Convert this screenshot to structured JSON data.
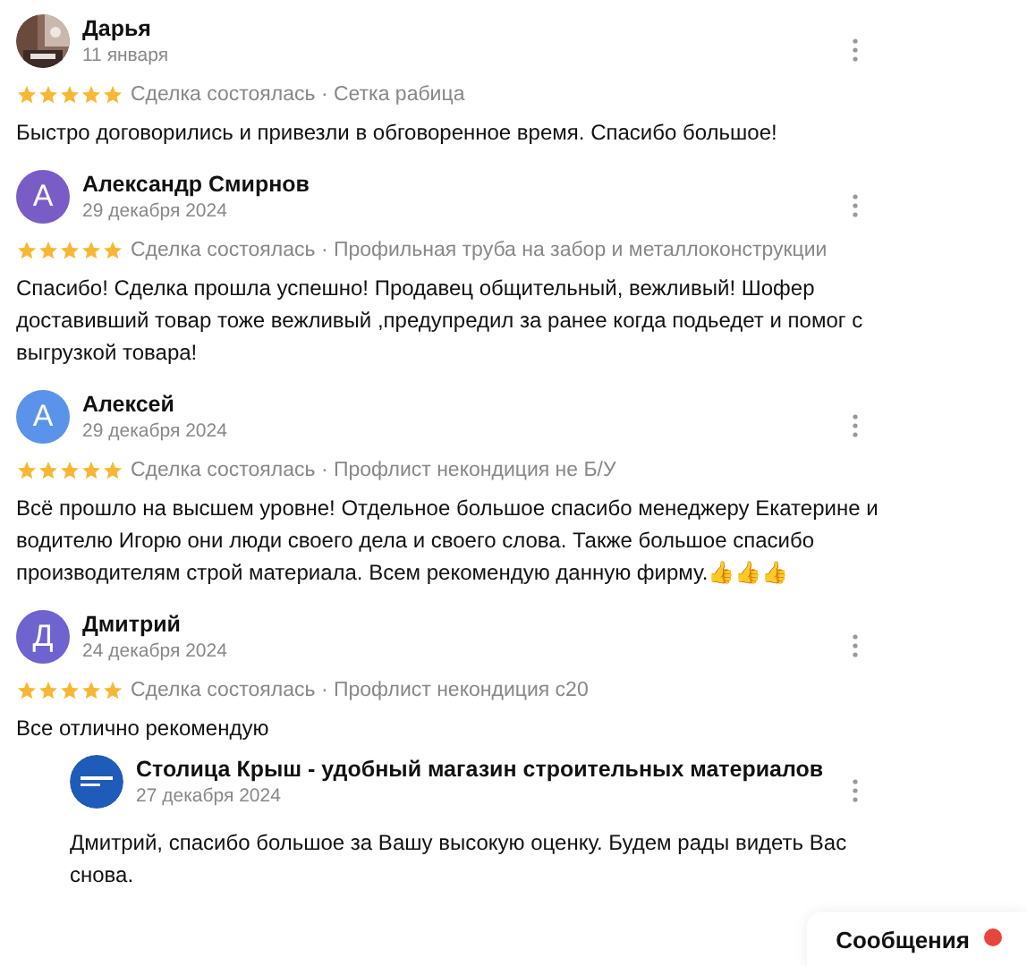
{
  "reviews": [
    {
      "author": "Дарья",
      "date": "11 января",
      "stars": 5,
      "deal": "Сделка состоялась · Сетка рабица",
      "text": "Быстро договорились и привезли в обговоренное время. Спасибо большое!"
    },
    {
      "author": "Александр Смирнов",
      "date": "29 декабря 2024",
      "avatar": {
        "kind": "letter",
        "letter": "А",
        "color": "#7a5cc7"
      },
      "stars": 5,
      "deal": "Сделка состоялась · Профильная труба на забор и металлоконструкции",
      "text": "Спасибо! Сделка прошла успешно! Продавец общительный, вежливый! Шофер доставивший товар тоже вежливый ,предупредил за ранее когда подьедет и помог с выгрузкой товара!"
    },
    {
      "author": "Алексей",
      "date": "29 декабря 2024",
      "avatar": {
        "kind": "letter",
        "letter": "А",
        "color": "#5b93ea"
      },
      "stars": 5,
      "deal": "Сделка состоялась · Профлист некондиция не Б/У",
      "text": "Всё прошло на высшем уровне! Отдельное большое спасибо менеджеру Екатерине и водителю Игорю они люди своего дела и своего слова. Также большое спасибо производителям строй материала. Всем рекомендую данную фирму.👍👍👍"
    },
    {
      "author": "Дмитрий",
      "date": "24 декабря 2024",
      "avatar": {
        "kind": "letter",
        "letter": "Д",
        "color": "#6f63cf"
      },
      "stars": 5,
      "deal": "Сделка состоялась · Профлист некондиция с20",
      "text": "Все отлично рекомендую",
      "reply": {
        "author": "Столица Крыш - удобный магазин строительных материалов",
        "date": "27 декабря 2024",
        "avatar": {
          "kind": "logo"
        },
        "text": "Дмитрий, спасибо большое за Вашу высокую оценку. Будем рады видеть Вас снова."
      }
    }
  ],
  "messages_button": {
    "label": "Сообщения",
    "badge": true
  }
}
